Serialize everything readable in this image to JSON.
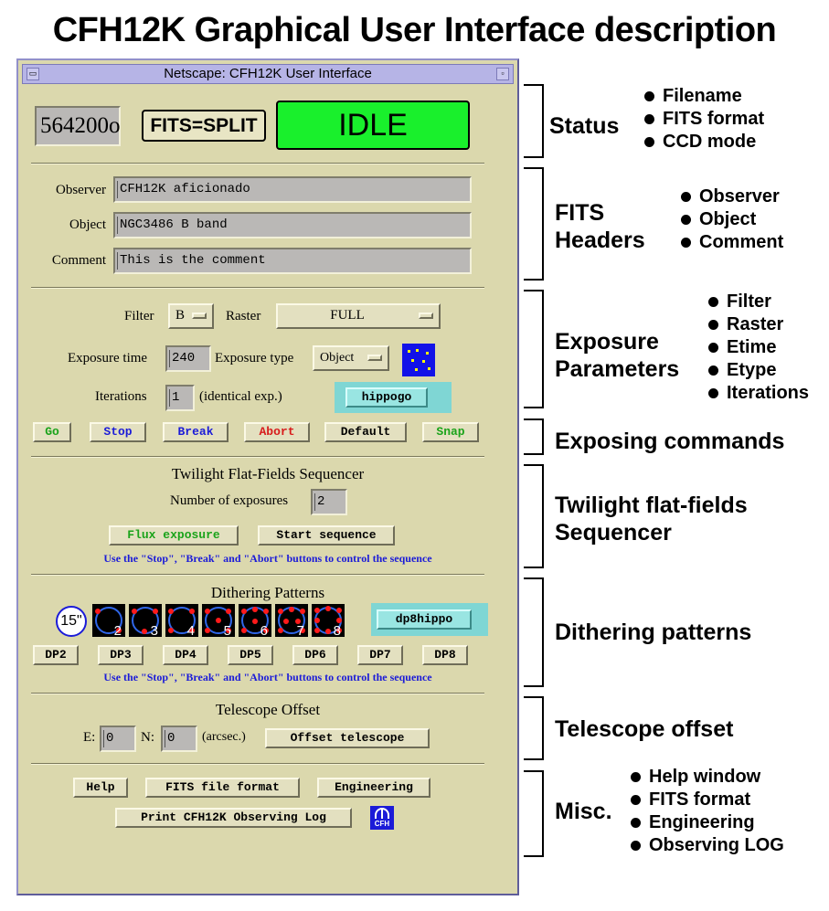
{
  "page_title": "CFH12K Graphical User Interface description",
  "window": {
    "title": "Netscape: CFH12K User Interface",
    "menu_glyph": "▭",
    "max_glyph": "▫"
  },
  "status": {
    "filename": "564200o",
    "fits_format": "FITS=SPLIT",
    "ccd_mode": "IDLE",
    "ccd_mode_color": "#19f02c"
  },
  "fits_headers": {
    "observer_label": "Observer",
    "observer_value": "CFH12K aficionado",
    "object_label": "Object",
    "object_value": "NGC3486 B band",
    "comment_label": "Comment",
    "comment_value": "This is the comment"
  },
  "exposure": {
    "filter_label": "Filter",
    "filter_value": "B",
    "raster_label": "Raster",
    "raster_value": "FULL",
    "etime_label": "Exposure time",
    "etime_value": "240",
    "etype_label": "Exposure type",
    "etype_value": "Object",
    "iterations_label": "Iterations",
    "iterations_value": "1",
    "iterations_note": "(identical exp.)",
    "hippogo_label": "hippogo",
    "pattern_icon": "dither-pattern-icon"
  },
  "commands": {
    "go": "Go",
    "stop": "Stop",
    "break": "Break",
    "abort": "Abort",
    "default": "Default",
    "snap": "Snap",
    "colors": {
      "go": "#1aa31a",
      "stop": "#1b1bd8",
      "break": "#1b1bd8",
      "abort": "#d81b1b",
      "default": "#000000",
      "snap": "#1aa31a"
    }
  },
  "twilight": {
    "title": "Twilight Flat-Fields Sequencer",
    "num_label": "Number of exposures",
    "num_value": "2",
    "flux_button": "Flux exposure",
    "start_button": "Start sequence",
    "note": "Use the \"Stop\", \"Break\" and \"Abort\" buttons to control the sequence"
  },
  "dithering": {
    "title": "Dithering Patterns",
    "first_label": "15\"",
    "tiles": [
      "2",
      "3",
      "4",
      "5",
      "6",
      "7",
      "8"
    ],
    "hippo_button": "dp8hippo",
    "buttons": [
      "DP2",
      "DP3",
      "DP4",
      "DP5",
      "DP6",
      "DP7",
      "DP8"
    ],
    "note": "Use the \"Stop\", \"Break\" and \"Abort\" buttons to control the sequence"
  },
  "offset": {
    "title": "Telescope Offset",
    "e_label": "E:",
    "e_value": "0",
    "n_label": "N:",
    "n_value": "0",
    "units": "(arcsec.)",
    "button": "Offset telescope"
  },
  "misc": {
    "help": "Help",
    "fits_format": "FITS file format",
    "engineering": "Engineering",
    "print_log": "Print CFH12K Observing Log",
    "logo_text": "CFH"
  },
  "annotations": {
    "status": {
      "title": "Status",
      "items": [
        "Filename",
        "FITS format",
        "CCD mode"
      ]
    },
    "fits": {
      "title_line1": "FITS",
      "title_line2": "Headers",
      "items": [
        "Observer",
        "Object",
        "Comment"
      ]
    },
    "exposure": {
      "title_line1": "Exposure",
      "title_line2": "Parameters",
      "items": [
        "Filter",
        "Raster",
        "Etime",
        "Etype",
        "Iterations"
      ]
    },
    "commands": {
      "title": "Exposing commands"
    },
    "twilight": {
      "title_line1": "Twilight flat-fields",
      "title_line2": "Sequencer"
    },
    "dithering": {
      "title": "Dithering patterns"
    },
    "offset": {
      "title": "Telescope offset"
    },
    "misc": {
      "title": "Misc.",
      "items": [
        "Help window",
        "FITS format",
        "Engineering",
        "Observing LOG"
      ]
    }
  }
}
